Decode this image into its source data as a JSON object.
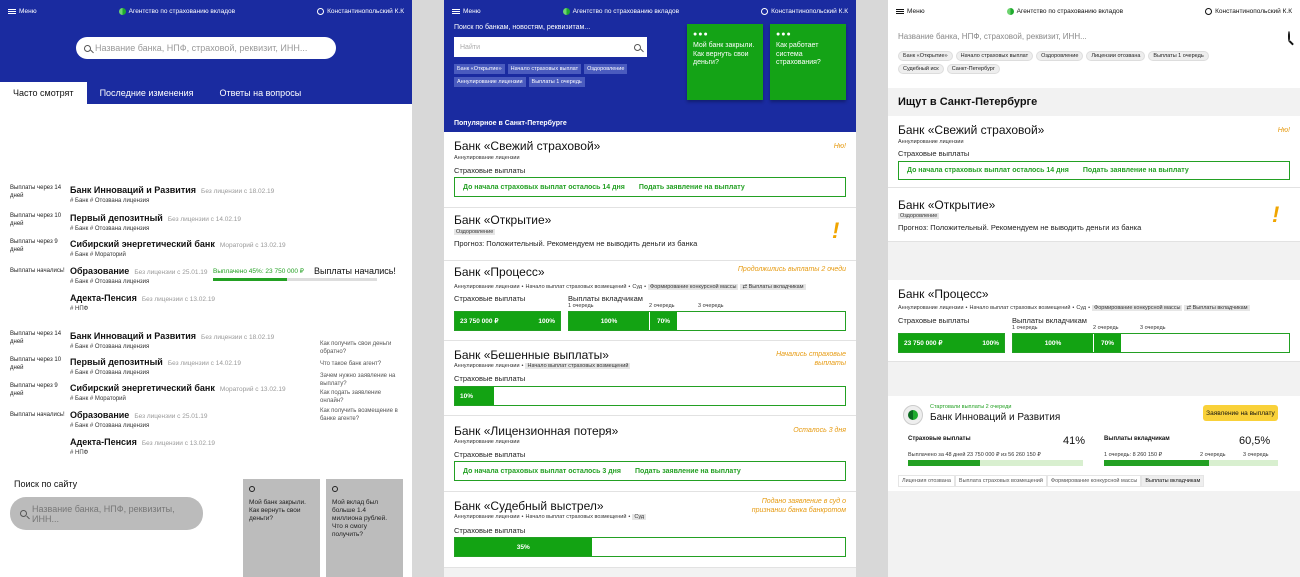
{
  "common": {
    "menu_label": "Меню",
    "agency": "Агентство по страхованию вкладов",
    "user": "Константинопольский К.К"
  },
  "panel1": {
    "search_placeholder": "Название банка, НПФ, страховой, реквизит, ИНН...",
    "tabs": [
      "Часто смотрят",
      "Последние изменения",
      "Ответы на вопросы"
    ],
    "rows": [
      {
        "status": "Выплаты через 14 дней",
        "name": "Банк Инноваций и Развития",
        "meta": "Без лицензии с 18.02.19",
        "tags": "# Банк  # Отозвана лицензия"
      },
      {
        "status": "Выплаты через 10 дней",
        "name": "Первый депозитный",
        "meta": "Без лицензии с 14.02.19",
        "tags": "# Банк  # Отозвана лицензия"
      },
      {
        "status": "Выплаты через 9 дней",
        "name": "Сибирский энергетический банк",
        "meta": "Мораторий с 13.02.19",
        "tags": "# Банк  # Мораторий"
      },
      {
        "status": "Выплаты начались!",
        "name": "Образование",
        "meta": "Без лицензии с 25.01.19",
        "tags": "# Банк  # Отозвана лицензия"
      },
      {
        "status": "",
        "name": "Адекта-Пенсия",
        "meta": "Без лицензии с 13.02.19",
        "tags": "# НПФ"
      },
      {
        "status": "Выплаты через 14 дней",
        "name": "Банк Инноваций и Развития",
        "meta": "Без лицензии с 18.02.19",
        "tags": "# Банк  # Отозвана лицензия"
      },
      {
        "status": "Выплаты через 10 дней",
        "name": "Первый депозитный",
        "meta": "Без лицензии с 14.02.19",
        "tags": "# Банк  # Отозвана лицензия"
      },
      {
        "status": "Выплаты через 9 дней",
        "name": "Сибирский энергетический банк",
        "meta": "Мораторий с 13.02.19",
        "tags": "# Банк  # Мораторий"
      },
      {
        "status": "Выплаты начались!",
        "name": "Образование",
        "meta": "Без лицензии с 25.01.19",
        "tags": "# Банк  # Отозвана лицензия"
      },
      {
        "status": "",
        "name": "Адекта-Пенсия",
        "meta": "Без лицензии с 13.02.19",
        "tags": "# НПФ"
      }
    ],
    "payout_progress": "Выплачено 45%: 23 750 000 ₽",
    "payout_progress_fraction": 0.45,
    "payout_started": "Выплаты начались!",
    "faq": [
      "Как получить свои деньги обратно?",
      "Что такое банк агент?",
      "Зачем нужно заявление на выплату?",
      "Как подать заявление онлайн?",
      "Как получить возмещение в банке агенте?"
    ],
    "site_search_title": "Поиск по сайту",
    "site_search_placeholder": "Название банка, НПФ, реквизиты, ИНН...",
    "cards": [
      "Мой банк закрыли. Как вернуть свои деньги?",
      "Мой вклад был больше 1.4 миллиона рублей. Что я смогу получить?"
    ]
  },
  "panel2": {
    "search_label": "Поиск по банкам, новостям, реквизитам...",
    "search_placeholder": "Найти",
    "chips": [
      "Банк «Открытие»",
      "Начало страховых выплат",
      "Оздоровление",
      "Аннулирование лицензии",
      "Выплаты 1 очередь"
    ],
    "cards": [
      "Мой банк закрыли. Как вернуть свои деньги?",
      "Как работает система страхования?"
    ],
    "popular_title": "Популярное в Санкт-Петербурге",
    "banks": {
      "fresh": {
        "name": "Банк «Свежий страховой»",
        "note": "Ню!",
        "tag": "Аннулирование лицензии",
        "label": "Страховые выплаты",
        "countdown": "До начала страховых выплат осталось 14 дня",
        "action": "Подать заявление на выплату"
      },
      "otkr": {
        "name": "Банк «Открытие»",
        "tag": "Оздоровление",
        "forecast": "Прогноз:  Положительный. Рекомендуем не выводить деньги из банка"
      },
      "process": {
        "name": "Банк «Процесс»",
        "note": "Продолжились выплаты 2 очеди",
        "tags": [
          "Аннулирование лицензии",
          "Начало выплат страховых возмещений",
          "Суд",
          "Формирование конкурсной массы",
          "⇄ Выплаты вкладчикам"
        ],
        "ins_label": "Страховые выплаты",
        "dep_label": "Выплаты вкладчикам",
        "amount": "23 750 000 ₽",
        "pct": "100%",
        "q1": "100%",
        "q2": "70%",
        "q_labels": [
          "1 очередь",
          "2 очередь",
          "3 очередь"
        ],
        "q2_fill": 0.7
      },
      "crazy": {
        "name": "Банк «Бешенные выплаты»",
        "note": "Начались страховые выплаты",
        "tags": [
          "Аннулирование лицензии",
          "Начало выплат страховых возмещений"
        ],
        "label": "Страховые выплаты",
        "pct": "10%",
        "fill": 0.1
      },
      "licloss": {
        "name": "Банк «Лицензионная потеря»",
        "note": "Осталось 3 дня",
        "tag": "Аннулирование лицензии",
        "label": "Страховые выплаты",
        "countdown": "До начала страховых выплат осталось 3 дня",
        "action": "Подать заявление на выплату"
      },
      "court": {
        "name": "Банк «Судебный выстрел»",
        "note": "Подано заявление в суд о признании банка банкротом",
        "tags": [
          "Аннулирование лицензии",
          "Начало выплат страховых возмещений",
          "Суд"
        ],
        "label": "Страховые выплаты",
        "pct": "35%",
        "fill": 0.35
      }
    }
  },
  "panel3": {
    "search_placeholder": "Название банка, НПФ, страховой, реквизит, ИНН...",
    "chips": [
      "Банк «Открытие»",
      "Начало страховых выплат",
      "Оздоровление",
      "Лицензии отозвана",
      "Выплаты 1 очередь",
      "Судебный иск",
      "Санкт-Петербург"
    ],
    "title": "Ищут в Санкт-Петербурге",
    "bank_card": {
      "subtitle": "Стартовали выплаты 2 очереди",
      "name": "Банк Инноваций и Развития",
      "button": "Заявление на выплату",
      "ins_label": "Страховые выплаты",
      "ins_pct": "41%",
      "ins_fill": 0.41,
      "ins_detail": "Выплачено за 48 дней 23 750 000 ₽ из 56 260 150 ₽",
      "dep_label": "Выплаты вкладчикам",
      "dep_pct": "60,5%",
      "dep_fill": 0.605,
      "dep_detail": "1 очередь: 8 260 150 ₽",
      "dep_q2": "2 очередь",
      "dep_q3": "3 очередь",
      "tabs": [
        "Лицензия отозвана",
        "Выплата страховых возмещений",
        "Формирование конкурсной массы",
        "Выплаты вкладчикам"
      ]
    }
  },
  "colors": {
    "brand_blue": "#1a2ba0",
    "green": "#23a023",
    "orange": "#e69a10",
    "yellow": "#f9d139"
  }
}
